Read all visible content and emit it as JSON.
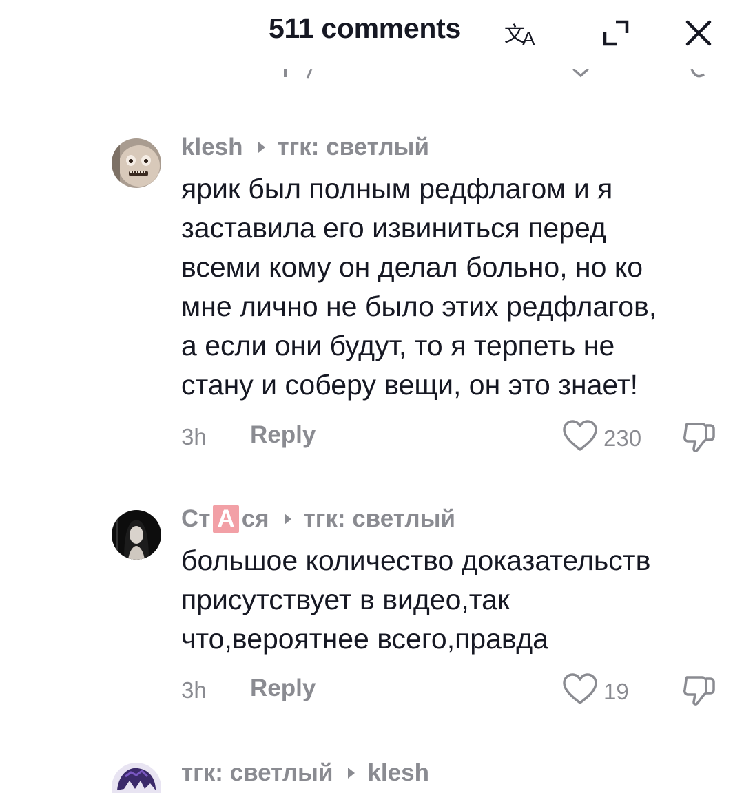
{
  "header": {
    "title": "511 comments",
    "icons": [
      "translate-icon",
      "expand-icon",
      "close-icon"
    ]
  },
  "colors": {
    "text_primary": "#161823",
    "text_secondary": "#8a8b91",
    "tag_highlight": "#f2a0a6"
  },
  "comments": [
    {
      "author": "klesh",
      "reply_to": "тгк: светлый",
      "text": "ярик был полным редфлагом и я\nзаставила его извиниться перед\nвсеми кому он делал больно, но ко\nмне лично не было этих редфлагов,\nа если они будут, то я терпеть не\nстану и соберу вещи, он это знает!",
      "time": "3h",
      "reply_label": "Reply",
      "likes": "230"
    },
    {
      "author_prefix": "Ст",
      "author_tag": "А",
      "author_suffix": "ся",
      "reply_to": "тгк: светлый",
      "text": "большое количество доказательств\nприсутствует в видео,так\nчто,вероятнее всего,правда",
      "time": "3h",
      "reply_label": "Reply",
      "likes": "19"
    },
    {
      "author": "тгк: светлый",
      "reply_to": "klesh"
    }
  ]
}
